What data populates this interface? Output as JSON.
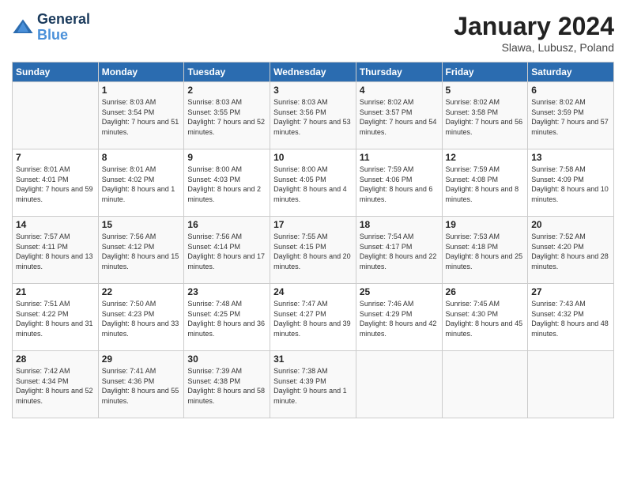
{
  "logo": {
    "line1": "General",
    "line2": "Blue"
  },
  "title": "January 2024",
  "subtitle": "Slawa, Lubusz, Poland",
  "days_of_week": [
    "Sunday",
    "Monday",
    "Tuesday",
    "Wednesday",
    "Thursday",
    "Friday",
    "Saturday"
  ],
  "weeks": [
    [
      {
        "day": "",
        "empty": true
      },
      {
        "day": "1",
        "sunrise": "8:03 AM",
        "sunset": "3:54 PM",
        "daylight": "7 hours and 51 minutes."
      },
      {
        "day": "2",
        "sunrise": "8:03 AM",
        "sunset": "3:55 PM",
        "daylight": "7 hours and 52 minutes."
      },
      {
        "day": "3",
        "sunrise": "8:03 AM",
        "sunset": "3:56 PM",
        "daylight": "7 hours and 53 minutes."
      },
      {
        "day": "4",
        "sunrise": "8:02 AM",
        "sunset": "3:57 PM",
        "daylight": "7 hours and 54 minutes."
      },
      {
        "day": "5",
        "sunrise": "8:02 AM",
        "sunset": "3:58 PM",
        "daylight": "7 hours and 56 minutes."
      },
      {
        "day": "6",
        "sunrise": "8:02 AM",
        "sunset": "3:59 PM",
        "daylight": "7 hours and 57 minutes."
      }
    ],
    [
      {
        "day": "7",
        "sunrise": "8:01 AM",
        "sunset": "4:01 PM",
        "daylight": "7 hours and 59 minutes."
      },
      {
        "day": "8",
        "sunrise": "8:01 AM",
        "sunset": "4:02 PM",
        "daylight": "8 hours and 1 minute."
      },
      {
        "day": "9",
        "sunrise": "8:00 AM",
        "sunset": "4:03 PM",
        "daylight": "8 hours and 2 minutes."
      },
      {
        "day": "10",
        "sunrise": "8:00 AM",
        "sunset": "4:05 PM",
        "daylight": "8 hours and 4 minutes."
      },
      {
        "day": "11",
        "sunrise": "7:59 AM",
        "sunset": "4:06 PM",
        "daylight": "8 hours and 6 minutes."
      },
      {
        "day": "12",
        "sunrise": "7:59 AM",
        "sunset": "4:08 PM",
        "daylight": "8 hours and 8 minutes."
      },
      {
        "day": "13",
        "sunrise": "7:58 AM",
        "sunset": "4:09 PM",
        "daylight": "8 hours and 10 minutes."
      }
    ],
    [
      {
        "day": "14",
        "sunrise": "7:57 AM",
        "sunset": "4:11 PM",
        "daylight": "8 hours and 13 minutes."
      },
      {
        "day": "15",
        "sunrise": "7:56 AM",
        "sunset": "4:12 PM",
        "daylight": "8 hours and 15 minutes."
      },
      {
        "day": "16",
        "sunrise": "7:56 AM",
        "sunset": "4:14 PM",
        "daylight": "8 hours and 17 minutes."
      },
      {
        "day": "17",
        "sunrise": "7:55 AM",
        "sunset": "4:15 PM",
        "daylight": "8 hours and 20 minutes."
      },
      {
        "day": "18",
        "sunrise": "7:54 AM",
        "sunset": "4:17 PM",
        "daylight": "8 hours and 22 minutes."
      },
      {
        "day": "19",
        "sunrise": "7:53 AM",
        "sunset": "4:18 PM",
        "daylight": "8 hours and 25 minutes."
      },
      {
        "day": "20",
        "sunrise": "7:52 AM",
        "sunset": "4:20 PM",
        "daylight": "8 hours and 28 minutes."
      }
    ],
    [
      {
        "day": "21",
        "sunrise": "7:51 AM",
        "sunset": "4:22 PM",
        "daylight": "8 hours and 31 minutes."
      },
      {
        "day": "22",
        "sunrise": "7:50 AM",
        "sunset": "4:23 PM",
        "daylight": "8 hours and 33 minutes."
      },
      {
        "day": "23",
        "sunrise": "7:48 AM",
        "sunset": "4:25 PM",
        "daylight": "8 hours and 36 minutes."
      },
      {
        "day": "24",
        "sunrise": "7:47 AM",
        "sunset": "4:27 PM",
        "daylight": "8 hours and 39 minutes."
      },
      {
        "day": "25",
        "sunrise": "7:46 AM",
        "sunset": "4:29 PM",
        "daylight": "8 hours and 42 minutes."
      },
      {
        "day": "26",
        "sunrise": "7:45 AM",
        "sunset": "4:30 PM",
        "daylight": "8 hours and 45 minutes."
      },
      {
        "day": "27",
        "sunrise": "7:43 AM",
        "sunset": "4:32 PM",
        "daylight": "8 hours and 48 minutes."
      }
    ],
    [
      {
        "day": "28",
        "sunrise": "7:42 AM",
        "sunset": "4:34 PM",
        "daylight": "8 hours and 52 minutes."
      },
      {
        "day": "29",
        "sunrise": "7:41 AM",
        "sunset": "4:36 PM",
        "daylight": "8 hours and 55 minutes."
      },
      {
        "day": "30",
        "sunrise": "7:39 AM",
        "sunset": "4:38 PM",
        "daylight": "8 hours and 58 minutes."
      },
      {
        "day": "31",
        "sunrise": "7:38 AM",
        "sunset": "4:39 PM",
        "daylight": "9 hours and 1 minute."
      },
      {
        "day": "",
        "empty": true
      },
      {
        "day": "",
        "empty": true
      },
      {
        "day": "",
        "empty": true
      }
    ]
  ]
}
